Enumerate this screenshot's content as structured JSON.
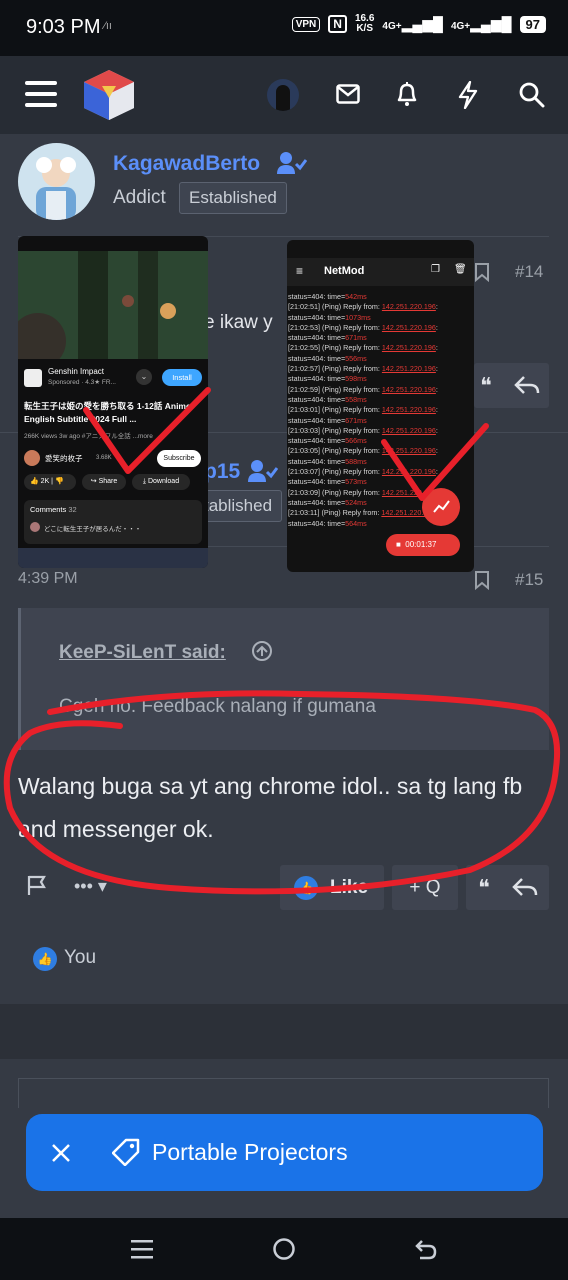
{
  "status_bar": {
    "time": "9:03 PM",
    "vpn": "VPN",
    "net_speed_top": "16.6",
    "net_speed_unit": "K/S",
    "sig1": "4G+",
    "sig2": "4G+",
    "battery": "97"
  },
  "nav": {
    "icons": [
      "menu-icon",
      "logo-icon",
      "avatar",
      "mail-icon",
      "bell-icon",
      "bolt-icon",
      "search-icon"
    ]
  },
  "post1": {
    "author": "KagawadBerto",
    "role": "Addict",
    "badge": "Established",
    "number": "#14",
    "text_fragment": "e ikaw y"
  },
  "post2": {
    "author_fragment": "p15",
    "badge_fragment": "tablished"
  },
  "post3": {
    "time": "4:39 PM",
    "number": "#15",
    "quote_author": "KeeP-SiLenT said:",
    "quote_text": "Cgeh no. Feedback nalang if gumana",
    "body": "Walang buga sa yt ang chrome idol.. sa tg lang fb and messenger ok.",
    "like_label": "Like",
    "quote_btn": "+ Q",
    "reaction_user": "You"
  },
  "yt_shot": {
    "ad_title": "Genshin Impact",
    "ad_sub": "Sponsored · 4.3★ FR...",
    "install": "Install",
    "video_title": "転生王子は姫の愛を勝ち取る 1-12話 Anime English Subtitle 2024 Full ...",
    "meta": "266K views 3w ago #アニメフル全話 ...more",
    "channel": "愛笑的枚子",
    "subs": "3.68K",
    "subscribe": "Subscribe",
    "likes": "2K",
    "share": "Share",
    "download": "Download",
    "comments_label": "Comments",
    "comments_count": "32",
    "comment_text": "どこに転生王子が居るんだ・・・"
  },
  "netmod_shot": {
    "title": "NetMod",
    "timer": "00:01:37",
    "log": [
      {
        "ts": "[21:02:51]",
        "ms": "1073ms"
      },
      {
        "ts": "[21:02:53]",
        "ms": "671ms"
      },
      {
        "ts": "[21:02:55]",
        "ms": "556ms"
      },
      {
        "ts": "[21:02:57]",
        "ms": "598ms"
      },
      {
        "ts": "[21:02:59]",
        "ms": "558ms"
      },
      {
        "ts": "[21:03:01]",
        "ms": "671ms"
      },
      {
        "ts": "[21:03:03]",
        "ms": "566ms"
      },
      {
        "ts": "[21:03:05]",
        "ms": "588ms"
      },
      {
        "ts": "[21:03:07]",
        "ms": "573ms"
      },
      {
        "ts": "[21:03:09]",
        "ms": "524ms"
      },
      {
        "ts": "[21:03:11]",
        "ms": "564ms"
      }
    ],
    "first_partial_ms": "542ms",
    "ping_text": "(Ping) Reply from: ",
    "ip": "142.251.220.196",
    "status_text": "status=404: time="
  },
  "banner": {
    "text": "Portable Projectors"
  },
  "colors": {
    "accent": "#5b8ff9",
    "red_mark": "#e8202a",
    "banner": "#1a73e8"
  }
}
